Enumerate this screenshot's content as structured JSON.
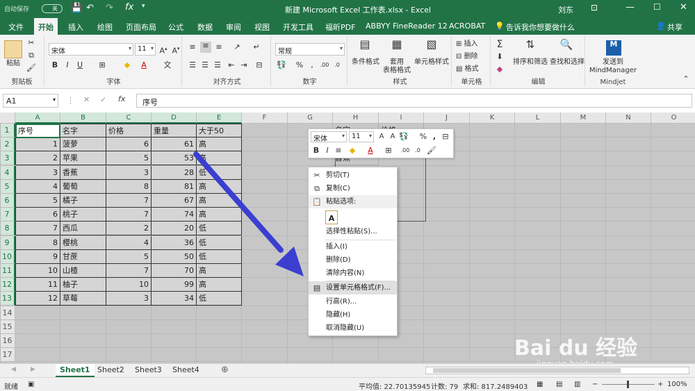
{
  "title_bar": {
    "autosave": "自动保存",
    "autosave_state": "关",
    "title": "新建 Microsoft Excel 工作表.xlsx  -  Excel",
    "user": "刘东"
  },
  "ribbon_tabs": [
    "文件",
    "开始",
    "插入",
    "绘图",
    "页面布局",
    "公式",
    "数据",
    "审阅",
    "视图",
    "开发工具",
    "福昕PDF",
    "ABBYY FineReader 12",
    "ACROBAT"
  ],
  "tell_me": "告诉我你想要做什么",
  "share": "共享",
  "ribbon": {
    "clipboard": {
      "paste": "粘贴",
      "label": "剪贴板"
    },
    "font": {
      "name": "宋体",
      "size": "11",
      "label": "字体"
    },
    "align": {
      "label": "对齐方式"
    },
    "number": {
      "format": "常规",
      "label": "数字"
    },
    "styles": {
      "cond": "条件格式",
      "table": "套用\n表格格式",
      "cell": "单元格样式",
      "label": "样式"
    },
    "cells": {
      "insert": "插入",
      "delete": "删除",
      "format": "格式",
      "label": "单元格"
    },
    "editing": {
      "sort": "排序和筛选",
      "find": "查找和选择",
      "label": "编辑"
    },
    "mindjet": {
      "send": "发送到\nMindManager",
      "label": "Mindjet"
    }
  },
  "formula_bar": {
    "name_box": "A1",
    "content": "序号",
    "fx": "fx"
  },
  "columns": [
    "A",
    "B",
    "C",
    "D",
    "E",
    "F",
    "G",
    "H",
    "I",
    "J",
    "K",
    "L",
    "M",
    "N",
    "O"
  ],
  "rows": [
    "1",
    "2",
    "3",
    "4",
    "5",
    "6",
    "7",
    "8",
    "9",
    "10",
    "11",
    "12",
    "13",
    "14",
    "15",
    "16",
    "17"
  ],
  "headers": [
    "序号",
    "名字",
    "价格",
    "重量",
    "大于50"
  ],
  "table": [
    [
      "1",
      "菠萝",
      "6",
      "61",
      "高"
    ],
    [
      "2",
      "苹果",
      "5",
      "53",
      "高"
    ],
    [
      "3",
      "香蕉",
      "3",
      "28",
      "低"
    ],
    [
      "4",
      "葡萄",
      "8",
      "81",
      "高"
    ],
    [
      "5",
      "橘子",
      "7",
      "67",
      "高"
    ],
    [
      "6",
      "桃子",
      "7",
      "74",
      "高"
    ],
    [
      "7",
      "西瓜",
      "2",
      "20",
      "低"
    ],
    [
      "8",
      "樱桃",
      "4",
      "36",
      "低"
    ],
    [
      "9",
      "甘蔗",
      "5",
      "50",
      "低"
    ],
    [
      "10",
      "山楂",
      "7",
      "70",
      "高"
    ],
    [
      "11",
      "柚子",
      "10",
      "99",
      "高"
    ],
    [
      "12",
      "草莓",
      "3",
      "34",
      "低"
    ]
  ],
  "partial_cells": {
    "h1": "名字",
    "i1": "价格",
    "h3": "香蕉"
  },
  "mini_toolbar": {
    "font": "宋体",
    "size": "11"
  },
  "context_menu": [
    {
      "label": "剪切(T)",
      "icon": "scissors-icon"
    },
    {
      "label": "复制(C)",
      "icon": "copy-icon"
    },
    {
      "label": "粘贴选项:",
      "icon": "clipboard-icon"
    },
    {
      "label": "选择性粘贴(S)...",
      "icon": ""
    },
    {
      "label": "插入(I)",
      "icon": ""
    },
    {
      "label": "删除(D)",
      "icon": ""
    },
    {
      "label": "清除内容(N)",
      "icon": ""
    },
    {
      "label": "设置单元格格式(F)...",
      "icon": "format-cells-icon"
    },
    {
      "label": "行高(R)...",
      "icon": ""
    },
    {
      "label": "隐藏(H)",
      "icon": ""
    },
    {
      "label": "取消隐藏(U)",
      "icon": ""
    }
  ],
  "sheets": [
    "Sheet1",
    "Sheet2",
    "Sheet3",
    "Sheet4"
  ],
  "status": {
    "ready": "就绪",
    "average": "平均值: 22.70135945",
    "count": "计数: 79",
    "sum": "求和: 817.2489403",
    "zoom": "100%"
  },
  "watermark": {
    "brand": "Bai du 经验",
    "url": "jingyan.baidu.com"
  },
  "colors": {
    "excel_green": "#217346",
    "arrow": "#3a3fd0"
  }
}
